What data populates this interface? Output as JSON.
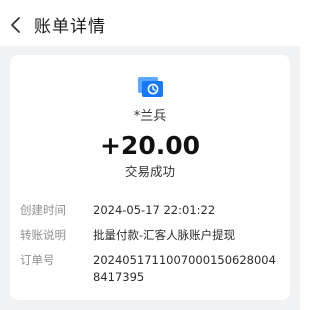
{
  "header": {
    "title": "账单详情",
    "back_icon": "chevron-left-icon"
  },
  "transaction": {
    "app_icon": "wallet-transfer-icon",
    "payee": "*兰兵",
    "amount": "+20.00",
    "status": "交易成功"
  },
  "details": [
    {
      "label": "创建时间",
      "value": "2024-05-17 22:01:22"
    },
    {
      "label": "转账说明",
      "value": "批量付款-汇客人脉账户提现"
    },
    {
      "label": "订单号",
      "value": "20240517110070001506280048417395"
    }
  ],
  "colors": {
    "accent": "#1677ff",
    "page_bg": "#f1f2f4"
  }
}
